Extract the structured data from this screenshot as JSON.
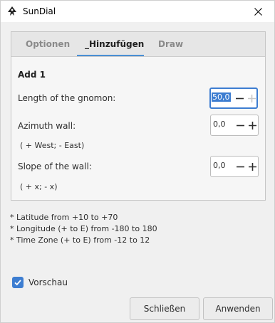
{
  "window": {
    "title": "SunDial"
  },
  "tabs": [
    {
      "label": "Optionen"
    },
    {
      "label": "_Hinzufügen"
    },
    {
      "label": "Draw"
    }
  ],
  "section": {
    "title": "Add 1"
  },
  "fields": {
    "gnomon": {
      "label": "Length of the gnomon:",
      "value": "50,0"
    },
    "azimuth": {
      "label": "Azimuth wall:",
      "value": "0,0",
      "hint": "( + West; - East)"
    },
    "slope": {
      "label": "Slope of the wall:",
      "value": "0,0",
      "hint": "( + x; - x)"
    }
  },
  "info_lines": [
    "* Latitude   from +10 to +70",
    "* Longitude (+ to E) from -180 to 180",
    "* Time Zone (+ to E) from -12 to 12"
  ],
  "preview": {
    "label": "Vorschau",
    "checked": true
  },
  "buttons": {
    "close": "Schließen",
    "apply": "Anwenden"
  },
  "colors": {
    "accent": "#3d7dd1",
    "tab_underline": "#4a8fd4"
  },
  "icons": {
    "app": "inkscape-logo-icon",
    "close": "close-icon",
    "minus": "minus-icon",
    "plus": "plus-icon",
    "check": "checkmark-icon"
  }
}
